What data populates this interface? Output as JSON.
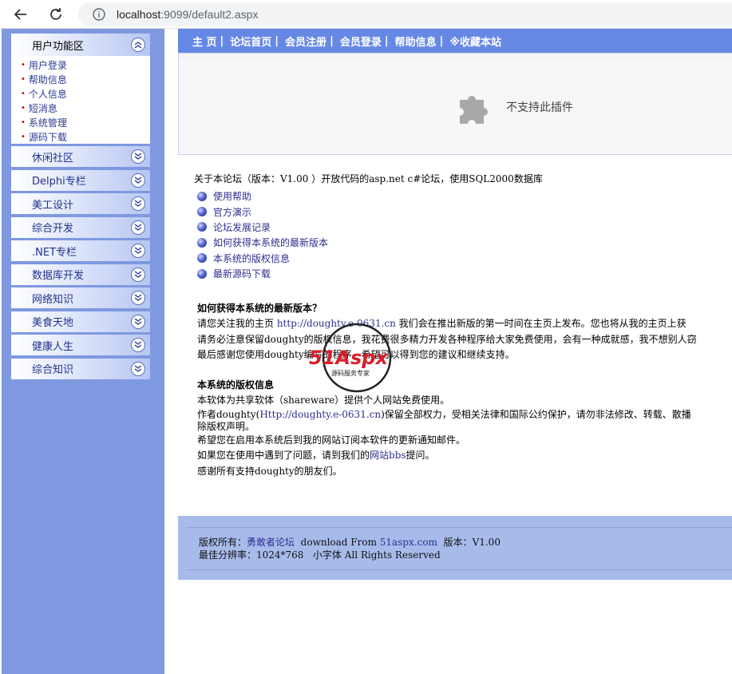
{
  "browser": {
    "url_host": "localhost",
    "url_rest": ":9099/default2.aspx"
  },
  "sidebar": {
    "open_menu": {
      "title": "用户功能区",
      "items": [
        "用户登录",
        "帮助信息",
        "个人信息",
        "短消息",
        "系统管理",
        "源码下载"
      ]
    },
    "closed_menus": [
      "休闲社区",
      "Delphi专栏",
      "美工设计",
      "综合开发",
      ".NET专栏",
      "数据库开发",
      "网络知识",
      "美食天地",
      "健康人生",
      "综合知识"
    ]
  },
  "topnav": {
    "items": [
      "主 页",
      "论坛首页",
      "会员注册",
      "会员登录",
      "帮助信息",
      "※收藏本站"
    ],
    "separator": "|"
  },
  "plugin": {
    "message": "不支持此插件"
  },
  "intro": {
    "about": "关于本论坛（版本：V1.00 ）开放代码的asp.net c#论坛，使用SQL2000数据库",
    "links": [
      "使用帮助",
      "官方演示",
      "论坛发展记录",
      "如何获得本系统的最新版本",
      "本系统的版权信息",
      "最新源码下载"
    ]
  },
  "section1": {
    "title": "如何获得本系统的最新版本？",
    "line1_a": "请您关注我的主页 ",
    "line1_link": "http://doughty.e-0631.cn",
    "line1_b": " 我们会在推出新版的第一时间在主页上发布。您也将从我的主页上获",
    "line2": "请务必注意保留doughty的版权信息，我花费很多精力开发各种程序给大家免费使用，会有一种成就感，我不想别人窃",
    "line3": "最后感谢您使用doughty编写的程序，希望可以得到您的建议和继续支持。"
  },
  "section2": {
    "title": "本系统的版权信息",
    "line1": "本软体为共享软体（shareware）提供个人网站免费使用。",
    "line2_a": "作者doughty(",
    "line2_link": "Http://doughty.e-0631.cn",
    "line2_b": ")保留全部权力，受相关法律和国际公约保护，请勿非法修改、转载、散播",
    "line3": "除版权声明。",
    "line4": "希望您在启用本系统后到我的网站订阅本软件的更新通知邮件。",
    "line5_a": "如果您在使用中遇到了问题，请到我们的",
    "line5_link": "网站bbs",
    "line5_b": "提问。",
    "line6": "感谢所有支持doughty的朋友们。"
  },
  "watermark": {
    "brand": "51Aspx",
    "tagline": "源码服务专家"
  },
  "footer": {
    "copyright_label": "版权所有：",
    "owner_link": "勇敢者论坛",
    "download_text": "  download From ",
    "download_link": "51aspx.com",
    "version": "  版本：V1.00",
    "line2": "最佳分辨率：1024*768   小字体 All Rights Reserved"
  },
  "colors": {
    "sidebar_bg": "#7f99e0",
    "nav_bg": "#6688e5",
    "footer_bg": "#a7bbeb",
    "link": "#2d2d8f"
  }
}
